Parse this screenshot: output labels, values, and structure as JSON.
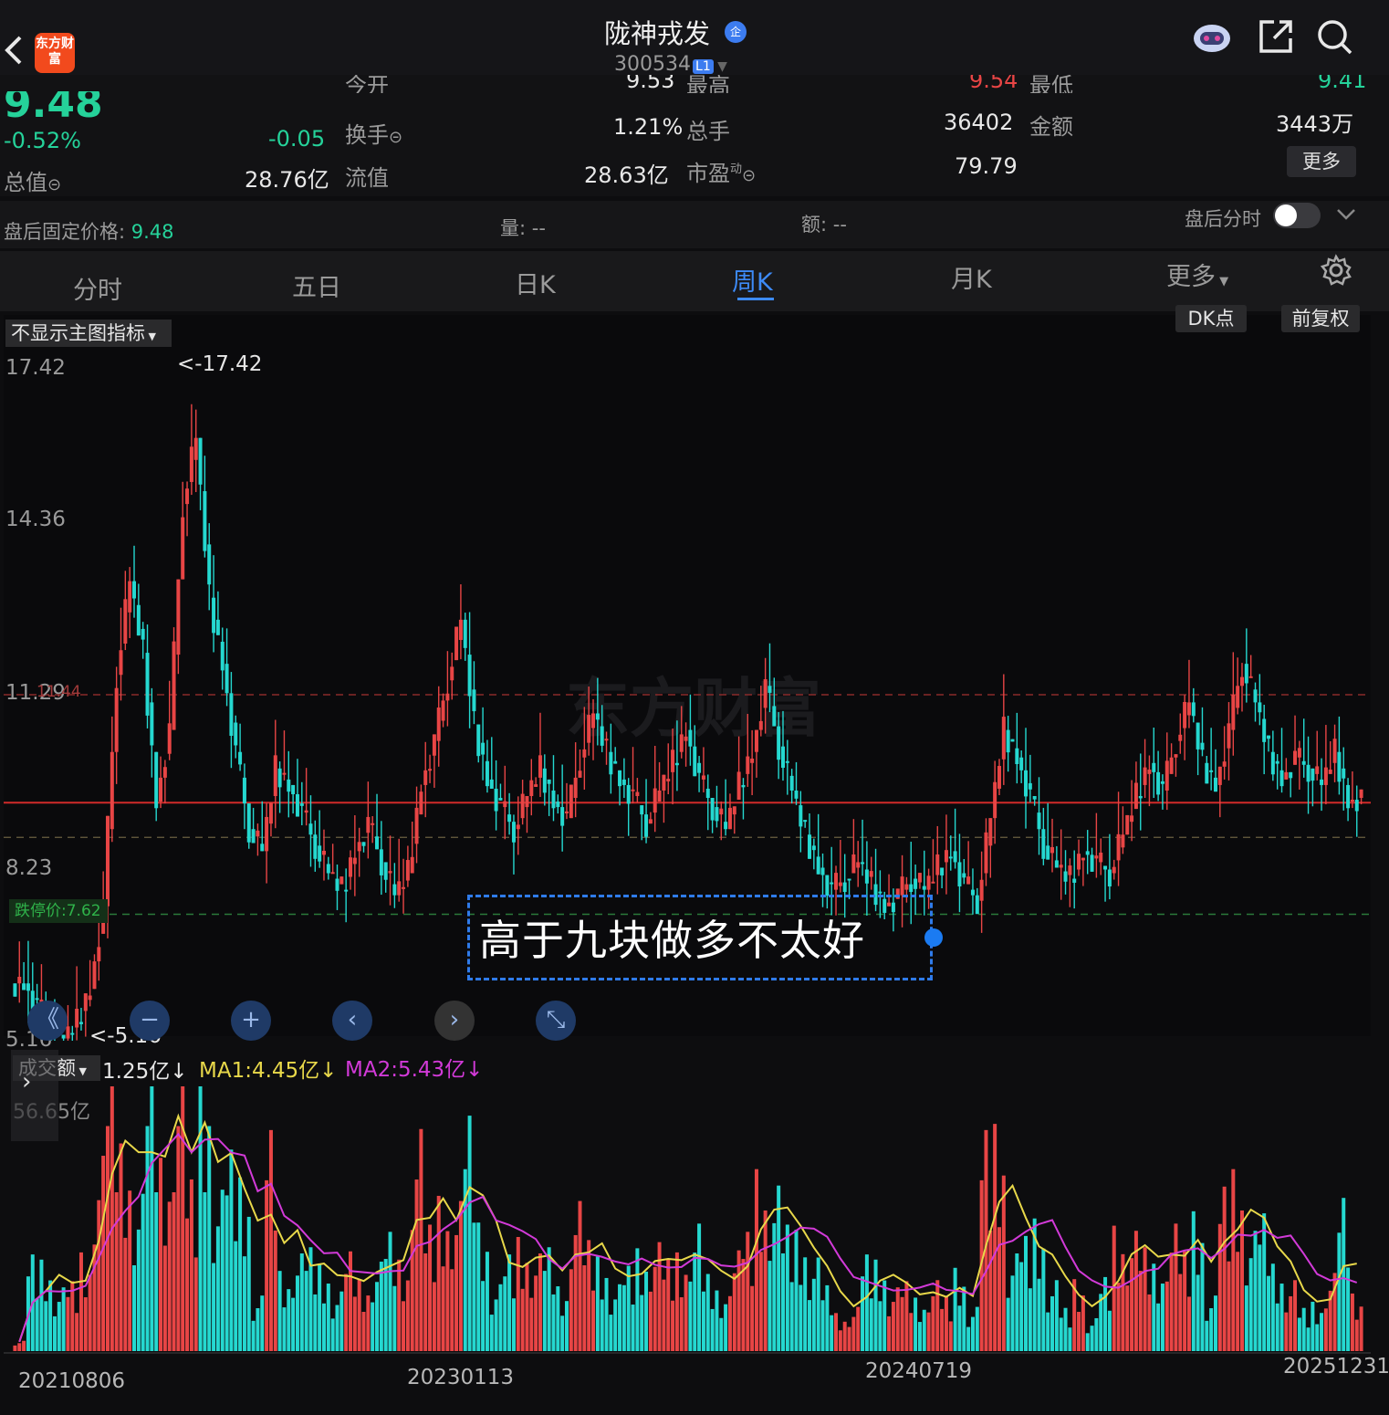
{
  "header": {
    "stock_name": "陇神戎发",
    "cert_badge": "企",
    "stock_code": "300534",
    "level_badge": "L1",
    "logo_text": "东方财富"
  },
  "quote": {
    "price": "9.48",
    "change_pct": "-0.52%",
    "change_abs": "-0.05",
    "cut_row": {
      "open_label": "今开",
      "open_value": "9.53",
      "high_label": "最高",
      "high_value": "9.54",
      "low_label": "最低",
      "low_value": "9.41"
    },
    "turnover_label": "换手",
    "turnover_value": "1.21%",
    "total_hand_label": "总手",
    "total_hand_value": "36402",
    "amount_label": "金额",
    "amount_value": "3443万",
    "total_value_label": "总值",
    "total_value_value": "28.76亿",
    "float_value_label": "流值",
    "float_value_value": "28.63亿",
    "pe_label": "市盈",
    "pe_sup": "动",
    "pe_value": "79.79",
    "more_label": "更多"
  },
  "afterhours": {
    "fixed_price_label": "盘后固定价格: ",
    "fixed_price_value": "9.48",
    "volume_label": "量: --",
    "amount_label": "额: --",
    "toggle_label": "盘后分时"
  },
  "tabs": [
    {
      "label": "分时"
    },
    {
      "label": "五日"
    },
    {
      "label": "日K"
    },
    {
      "label": "周K"
    },
    {
      "label": "月K"
    },
    {
      "label": "更多"
    }
  ],
  "chart": {
    "indicator_select": "不显示主图指标",
    "dk_button": "DK点",
    "adjust_button": "前复权",
    "y_labels": [
      "17.42",
      "14.36",
      "11.29",
      "8.23",
      "5.16"
    ],
    "high_marker": "<-17.42",
    "low_marker": "<-5.16",
    "limit_up_label": "11.44",
    "limit_down_label": "跌停价:7.62",
    "annotation": "高于九块做多不太好",
    "watermark": "东方财富",
    "nav_buttons": [
      "《",
      "−",
      "+",
      "‹",
      "›",
      "⤡"
    ]
  },
  "volume": {
    "selector": "成交额",
    "current": "1.25亿↓",
    "ma1": "MA1:4.45亿↓",
    "ma2": "MA2:5.43亿↓",
    "max_label": "56.65亿",
    "dates": [
      "20210806",
      "20230113",
      "20240719",
      "20251231"
    ]
  },
  "colors": {
    "up": "#e84545",
    "down": "#25d8d0",
    "accent": "#3d8af7",
    "ma1": "#e8d84a",
    "ma2": "#d23ad8"
  },
  "chart_data": {
    "type": "candlestick",
    "period": "weekly",
    "ylim": [
      5.16,
      17.42
    ],
    "high": 17.42,
    "low": 5.16,
    "current_price": 9.48,
    "limit_down": 7.62,
    "limit_up": 11.44,
    "close_series": [
      6.2,
      5.8,
      5.4,
      5.2,
      5.5,
      6.1,
      7.6,
      11.8,
      13.5,
      12.2,
      9.5,
      10.8,
      14.9,
      16.1,
      13.2,
      12.0,
      10.4,
      9.0,
      8.6,
      10.1,
      9.8,
      9.3,
      8.7,
      8.2,
      7.9,
      8.6,
      9.1,
      8.4,
      7.8,
      8.2,
      9.8,
      10.6,
      11.7,
      12.8,
      10.9,
      9.9,
      9.4,
      9.0,
      9.6,
      10.1,
      9.5,
      9.2,
      10.3,
      11.1,
      10.4,
      9.9,
      9.6,
      9.1,
      9.7,
      10.2,
      10.8,
      9.9,
      9.4,
      9.0,
      9.8,
      10.4,
      11.6,
      10.5,
      9.7,
      8.9,
      8.3,
      7.9,
      8.1,
      8.4,
      8.0,
      7.6,
      7.8,
      8.1,
      7.9,
      8.3,
      8.6,
      8.0,
      7.7,
      9.2,
      10.8,
      10.3,
      9.6,
      8.7,
      8.3,
      8.1,
      8.6,
      8.4,
      8.2,
      8.9,
      9.6,
      10.2,
      9.7,
      10.6,
      11.3,
      10.2,
      9.8,
      10.8,
      12.0,
      11.3,
      10.4,
      9.9,
      10.3,
      10.1,
      9.8,
      10.4,
      9.5,
      9.6
    ],
    "volume_max": 56.65,
    "volume_unit": "亿",
    "x_dates": [
      "20210806",
      "20230113",
      "20240719",
      "20251231"
    ]
  }
}
